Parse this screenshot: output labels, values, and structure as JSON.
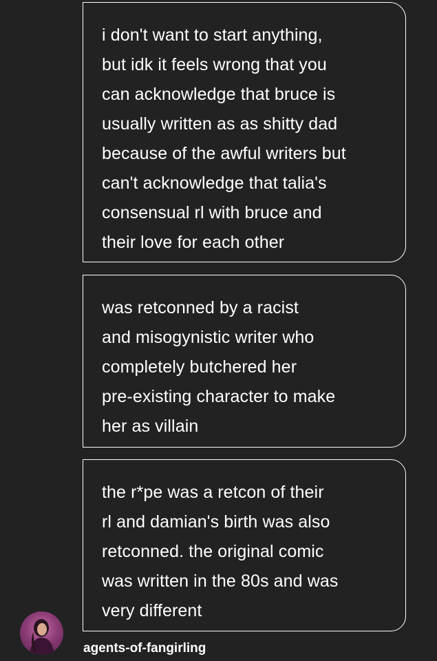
{
  "messages": [
    {
      "text": "i don't want to start anything,\nbut idk it feels wrong that you\ncan acknowledge that bruce is\nusually written as as shitty dad\nbecause of the awful writers but\ncan't acknowledge that talia's\nconsensual rl with bruce and\ntheir love for each other"
    },
    {
      "text": "was retconned by a racist\nand misogynistic writer who\ncompletely butchered her\npre-existing character to make\nher as villain"
    },
    {
      "text": "the r*pe was a retcon of their\nrl and damian's birth was also\nretconned. the original comic\nwas written in the 80s and was\nvery different"
    }
  ],
  "sender": {
    "username": "agents-of-fangirling",
    "avatar_icon": "user-avatar"
  },
  "colors": {
    "background": "#222223",
    "text": "#ffffff",
    "bubble_border": "#ffffff"
  }
}
